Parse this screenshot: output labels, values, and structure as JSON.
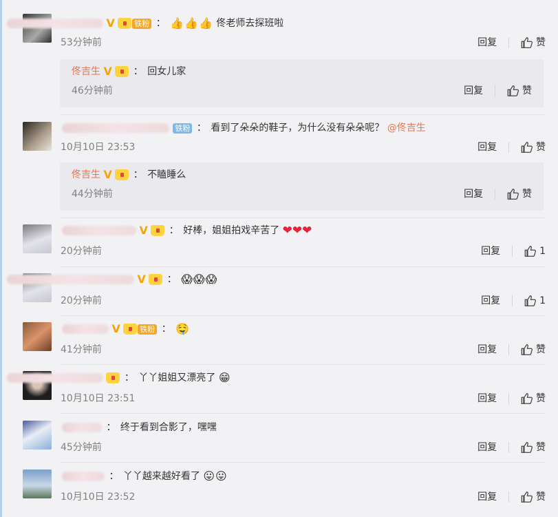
{
  "actions": {
    "reply_label": "回复",
    "like_label": "赞"
  },
  "badges": {
    "fan_iron": "铁粉"
  },
  "comments": [
    {
      "time": "53分钟前",
      "text": "佟老师去探班啦",
      "emoji": "👍👍👍",
      "like": "赞",
      "reply": {
        "author": "佟吉生",
        "text": "回女儿家",
        "time": "46分钟前"
      }
    },
    {
      "time": "10月10日 23:53",
      "text": "看到了朵朵的鞋子，为什么没有朵朵呢？",
      "mention": "@佟吉生",
      "like": "赞",
      "reply": {
        "author": "佟吉生",
        "text": "不瞌睡么",
        "time": "44分钟前"
      }
    },
    {
      "time": "20分钟前",
      "text": "好棒，姐姐拍戏辛苦了",
      "hearts": "❤❤❤",
      "like": "1"
    },
    {
      "time": "20分钟前",
      "emoji": "😱😱😱",
      "like": "1"
    },
    {
      "time": "41分钟前",
      "emoji": "🤤",
      "like": "赞"
    },
    {
      "time": "10月10日 23:51",
      "text": "丫丫姐姐又漂亮了",
      "emoji": "😁",
      "like": "赞"
    },
    {
      "time": "45分钟前",
      "text": "终于看到合影了，嘿嘿",
      "like": "赞"
    },
    {
      "time": "10月10日 23:52",
      "text": "丫丫越来越好看了",
      "emoji": "😛😛",
      "like": "赞"
    }
  ],
  "colors": {
    "accent": "#eb7350",
    "vip": "#f7a400",
    "fan_orange": "#f5a623",
    "fan_blue": "#7fb9ea",
    "heart": "#e8233a"
  },
  "icons": {
    "like": "thumbs-up-icon",
    "vip": "verified-v-icon",
    "crown": "crown-icon"
  }
}
